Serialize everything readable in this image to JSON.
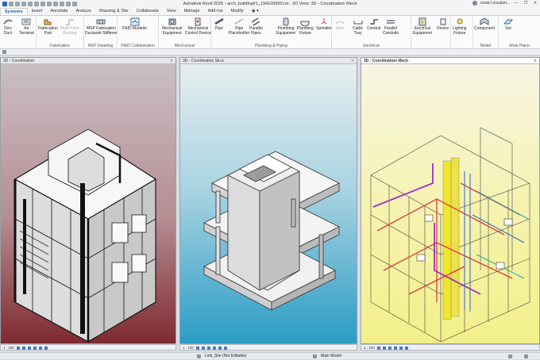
{
  "window": {
    "title": "Autodesk Revit 2025 - arch_building#1_194109990.rvt - 3D View: 3D - Coordination Mech",
    "user": "cesar.l.escalan...",
    "controls": [
      "—",
      "❐",
      "✕"
    ]
  },
  "tabs": [
    "Systems",
    "Insert",
    "Annotate",
    "Analyze",
    "Massing & Site",
    "Collaborate",
    "View",
    "Manage",
    "Add-Ins",
    "Modify",
    "◉ ▾"
  ],
  "active_tab": "Systems",
  "ribbon": {
    "buttons": {
      "flex_duct": "Flex\nDuct",
      "air_terminal": "Air\nTerminal",
      "fabrication_part": "Fabrication\nPart",
      "multipoint_routing": "Multi-Point\nRouting",
      "msp_fabrication_stiffener": "MSP Fabrication\nDuctwork Stiffener",
      "pid_modeler": "P&ID Modeler",
      "mechanical_equipment": "Mechanical\nEquipment",
      "mechanical_control_device": "Mechanical\nControl Device",
      "pipe": "Pipe",
      "pipe_placeholder": "Pipe\nPlaceholder",
      "parallel_pipes": "Parallel\nPipes",
      "plumbing_equipment": "Plumbing\nEquipment",
      "plumbing_fixture": "Plumbing\nFixture",
      "sprinkler": "Sprinkler",
      "wire": "Wire",
      "cable_tray": "Cable\nTray",
      "conduit": "Conduit",
      "parallel_conduits": "Parallel\nConduits",
      "electrical_equipment": "Electrical\nEquipment",
      "device": "Device",
      "lighting_fixture": "Lighting\nFixture",
      "component": "Component",
      "set": "Set"
    },
    "groups": {
      "fabrication": "Fabrication",
      "msp_detailing": "MSP Detailing",
      "pid_collaboration": "P&ID Collaboration",
      "mechanical": "Mechanical",
      "plumbing_piping": "Plumbing & Piping",
      "electrical": "Electrical",
      "model": "Model",
      "work_plane": "Work Plane"
    }
  },
  "views": [
    {
      "title": "3D - Coordination",
      "scale": "1 : 100"
    },
    {
      "title": "3D - Coordination Struc",
      "scale": "1 : 100"
    },
    {
      "title": "3D - Coordination Mech",
      "scale": "1 : 100"
    }
  ],
  "status": {
    "workset": "Link_Site (Not Editable)",
    "model": "Main Model"
  },
  "colors": {
    "arch_bg_top": "#c9bfc3",
    "arch_bg_bottom": "#7e2a30",
    "struc_bg_top": "#d6e6ea",
    "struc_bg_bottom": "#2a9cc4",
    "mech_bg_top": "#f7f5e4",
    "mech_bg_bottom": "#f3f08a",
    "accent": "#0b5cab"
  }
}
